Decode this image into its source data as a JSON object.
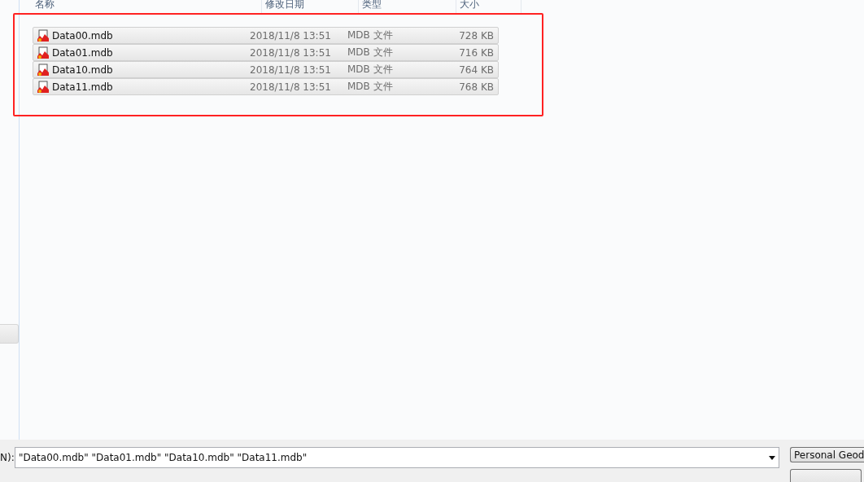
{
  "columns": [
    {
      "label": "名称"
    },
    {
      "label": "修改日期"
    },
    {
      "label": "类型"
    },
    {
      "label": "大小"
    }
  ],
  "files": [
    {
      "name": "Data00.mdb",
      "modified": "2018/11/8 13:51",
      "type": "MDB 文件",
      "size": "728 KB",
      "selected": true
    },
    {
      "name": "Data01.mdb",
      "modified": "2018/11/8 13:51",
      "type": "MDB 文件",
      "size": "716 KB",
      "selected": true
    },
    {
      "name": "Data10.mdb",
      "modified": "2018/11/8 13:51",
      "type": "MDB 文件",
      "size": "764 KB",
      "selected": true
    },
    {
      "name": "Data11.mdb",
      "modified": "2018/11/8 13:51",
      "type": "MDB 文件",
      "size": "768 KB",
      "selected": true
    }
  ],
  "filename": {
    "label": "N):",
    "value": "\"Data00.mdb\" \"Data01.mdb\" \"Data10.mdb\" \"Data11.mdb\""
  },
  "filter_button": "Personal Geod"
}
